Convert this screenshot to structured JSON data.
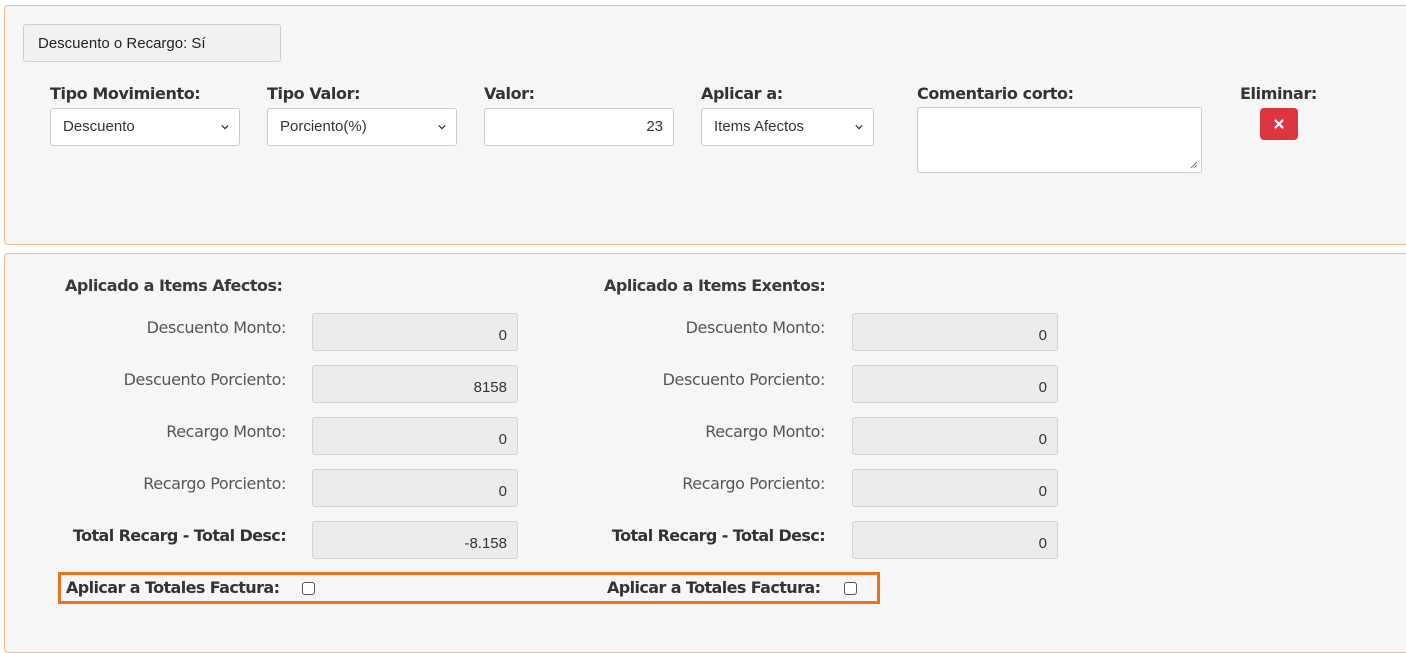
{
  "discount_toggle": {
    "label": "Descuento o Recargo: Sí"
  },
  "form": {
    "tipo_movimiento": {
      "label": "Tipo Movimiento:",
      "selected": "Descuento"
    },
    "tipo_valor": {
      "label": "Tipo Valor:",
      "selected": "Porciento(%)"
    },
    "valor": {
      "label": "Valor:",
      "value": "23"
    },
    "aplicar_a": {
      "label": "Aplicar a:",
      "selected": "Items Afectos"
    },
    "comentario": {
      "label": "Comentario corto:",
      "value": ""
    },
    "eliminar": {
      "label": "Eliminar:",
      "icon": "close-icon"
    }
  },
  "afectos": {
    "title": "Aplicado a Items Afectos:",
    "descuento_monto": {
      "label": "Descuento Monto:",
      "value": "0"
    },
    "descuento_porciento": {
      "label": "Descuento Porciento:",
      "value": "8158"
    },
    "recargo_monto": {
      "label": "Recargo Monto:",
      "value": "0"
    },
    "recargo_porciento": {
      "label": "Recargo Porciento:",
      "value": "0"
    },
    "total": {
      "label": "Total Recarg - Total Desc:",
      "value": "-8.158"
    },
    "aplicar_totales": {
      "label": "Aplicar a Totales Factura:",
      "checked": false
    }
  },
  "exentos": {
    "title": "Aplicado a Items Exentos:",
    "descuento_monto": {
      "label": "Descuento Monto:",
      "value": "0"
    },
    "descuento_porciento": {
      "label": "Descuento Porciento:",
      "value": "0"
    },
    "recargo_monto": {
      "label": "Recargo Monto:",
      "value": "0"
    },
    "recargo_porciento": {
      "label": "Recargo Porciento:",
      "value": "0"
    },
    "total": {
      "label": "Total Recarg - Total Desc:",
      "value": "0"
    },
    "aplicar_totales": {
      "label": "Aplicar a Totales Factura:",
      "checked": false
    }
  },
  "colors": {
    "accent_border": "#e8731e",
    "danger": "#dc3540",
    "panel_border": "#f0b98d"
  }
}
